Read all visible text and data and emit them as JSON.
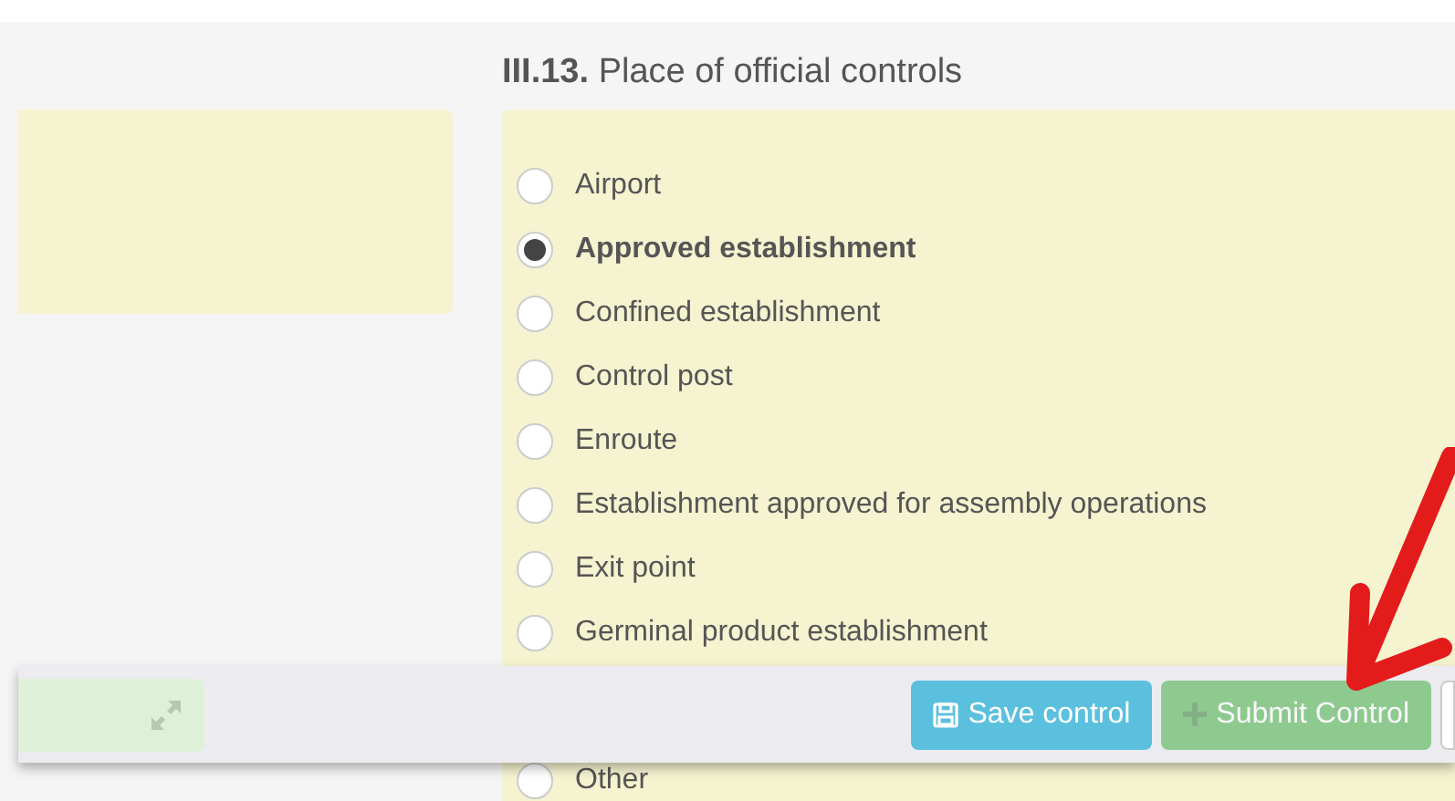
{
  "section": {
    "number": "III.13.",
    "title": "Place of official controls"
  },
  "options": [
    {
      "label": "Airport",
      "selected": false
    },
    {
      "label": "Approved establishment",
      "selected": true
    },
    {
      "label": "Confined establishment",
      "selected": false
    },
    {
      "label": "Control post",
      "selected": false
    },
    {
      "label": "Enroute",
      "selected": false
    },
    {
      "label": "Establishment approved for assembly operations",
      "selected": false
    },
    {
      "label": "Exit point",
      "selected": false
    },
    {
      "label": "Germinal product establishment",
      "selected": false
    },
    {
      "label": "Other",
      "selected": false
    }
  ],
  "footer": {
    "buttons": [
      {
        "label": "Save control",
        "kind": "save",
        "disabled": false
      },
      {
        "label": "Submit Control",
        "kind": "submit",
        "disabled": true
      }
    ]
  }
}
